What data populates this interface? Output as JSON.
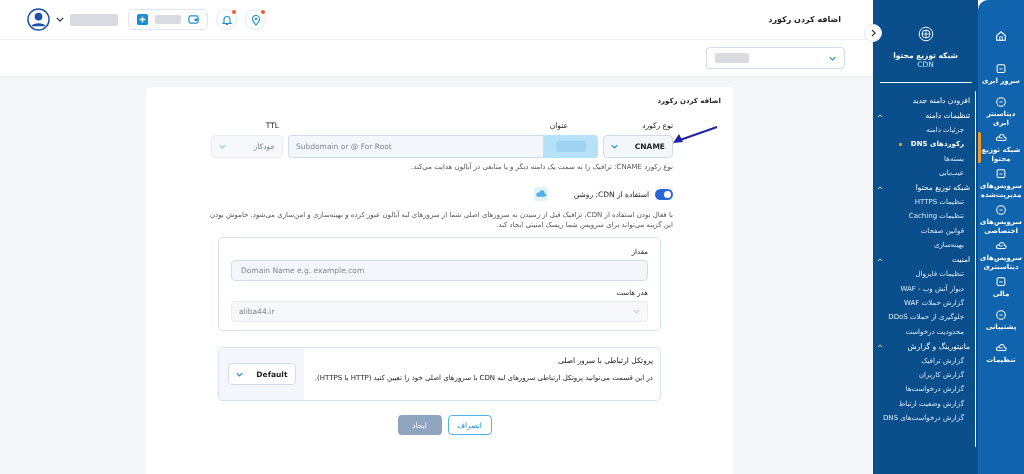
{
  "top_bar": {
    "title": "اضافه کردن رکورد",
    "alerts": [
      {
        "kind": "bell",
        "unread": true
      },
      {
        "kind": "pin",
        "unread": true
      }
    ]
  },
  "card": {
    "title": "اضافه کردن رکورد",
    "record_type": {
      "label": "نوع رکورد",
      "value": "CNAME"
    },
    "name_field": {
      "label": "عنوان",
      "placeholder": "Subdomain or @ For Root"
    },
    "ttl": {
      "label": "TTL",
      "value": "خودکار",
      "disabled": true
    },
    "hint": "نوع رکورد CNAME: ترافیک را به سمت یک دامنه دیگر و یا منابعی در آبالون هدایت می‌کند.",
    "cdn_toggle": {
      "label": "استفاده از CDN: روشن",
      "on": true
    },
    "cdn_description": "با فعال بودن استفاده از CDN، ترافیک قبل از رسیدن به سرورهای اصلی شما از سرورهای لبه آبالون عبور کرده و بهینه‌سازی و امن‌سازی می‌شود. خاموش بودن این گزینه می‌تواند برای سرویس شما ریسک امنیتی ایجاد کند.",
    "value_field": {
      "label": "مقدار",
      "placeholder": "Domain Name e.g. example.com"
    },
    "host_header": {
      "label": "هدر هاست",
      "value": "aliba44.ir",
      "disabled": true
    },
    "protocol": {
      "title": "پروتکل ارتباطی با سرور اصلی",
      "description": "در این قسمت می‌توانید پروتکل ارتباطی سرورهای لبه CDN با سرورهای اصلی خود را تعیین کنید (HTTP یا HTTPS).",
      "value": "Default"
    },
    "buttons": [
      {
        "label": "انصراف",
        "kind": "outline",
        "disabled": false
      },
      {
        "label": "ایجاد",
        "kind": "primary",
        "disabled": true
      }
    ]
  },
  "sidebar": {
    "title": "شبکه توزیع محتوا",
    "subtitle": "CDN",
    "items": [
      {
        "label": "افزودن دامنه جدید",
        "selected": false
      },
      {
        "label": "تنظیمات دامنه",
        "expanded": true,
        "children": [
          {
            "label": "جزئیات دامنه",
            "selected": false
          },
          {
            "label": "رکوردهای DNS",
            "selected": true
          },
          {
            "label": "بسته‌ها",
            "selected": false
          },
          {
            "label": "عیب‌یابی",
            "selected": false
          }
        ]
      },
      {
        "label": "شبکه توزیع محتوا",
        "expanded": true,
        "children": [
          {
            "label": "تنظیمات HTTPS",
            "selected": false
          },
          {
            "label": "تنظیمات Caching",
            "selected": false
          },
          {
            "label": "قوانین صفحات",
            "selected": false
          },
          {
            "label": "بهینه‌سازی",
            "selected": false
          }
        ]
      },
      {
        "label": "امنیت",
        "expanded": true,
        "children": [
          {
            "label": "تنظیمات فایروال",
            "selected": false
          },
          {
            "label": "دیوار آتش وب - WAF",
            "selected": false
          },
          {
            "label": "گزارش حملات WAF",
            "selected": false
          },
          {
            "label": "جلوگیری از حملات DDoS",
            "selected": false
          },
          {
            "label": "محدودیت درخواست",
            "selected": false
          }
        ]
      },
      {
        "label": "مانیتورینگ و گزارش",
        "expanded": true,
        "children": [
          {
            "label": "گزارش ترافیک",
            "selected": false
          },
          {
            "label": "گزارش کاربران",
            "selected": false
          },
          {
            "label": "گزارش درخواست‌ها",
            "selected": false
          },
          {
            "label": "گزارش وضعیت ارتباط",
            "selected": false
          },
          {
            "label": "گزارش درخواست‌های DNS",
            "selected": false
          }
        ]
      }
    ]
  },
  "rail": {
    "items": [
      {
        "label": "سرور ابری",
        "selected": false
      },
      {
        "label": "دیتاسنتر ابری",
        "selected": false
      },
      {
        "label": "شبکه توزیع محتوا",
        "selected": true
      },
      {
        "label": "سرویس‌های مدیریت‌شده",
        "selected": false
      },
      {
        "label": "سرویس‌های اختصاصی",
        "selected": false
      },
      {
        "label": "سرویس‌های دیتاسنتری",
        "selected": false
      },
      {
        "label": "مالی",
        "selected": false
      },
      {
        "label": "پشتیبانی",
        "selected": false
      },
      {
        "label": "تنظیمات",
        "selected": false
      }
    ]
  }
}
